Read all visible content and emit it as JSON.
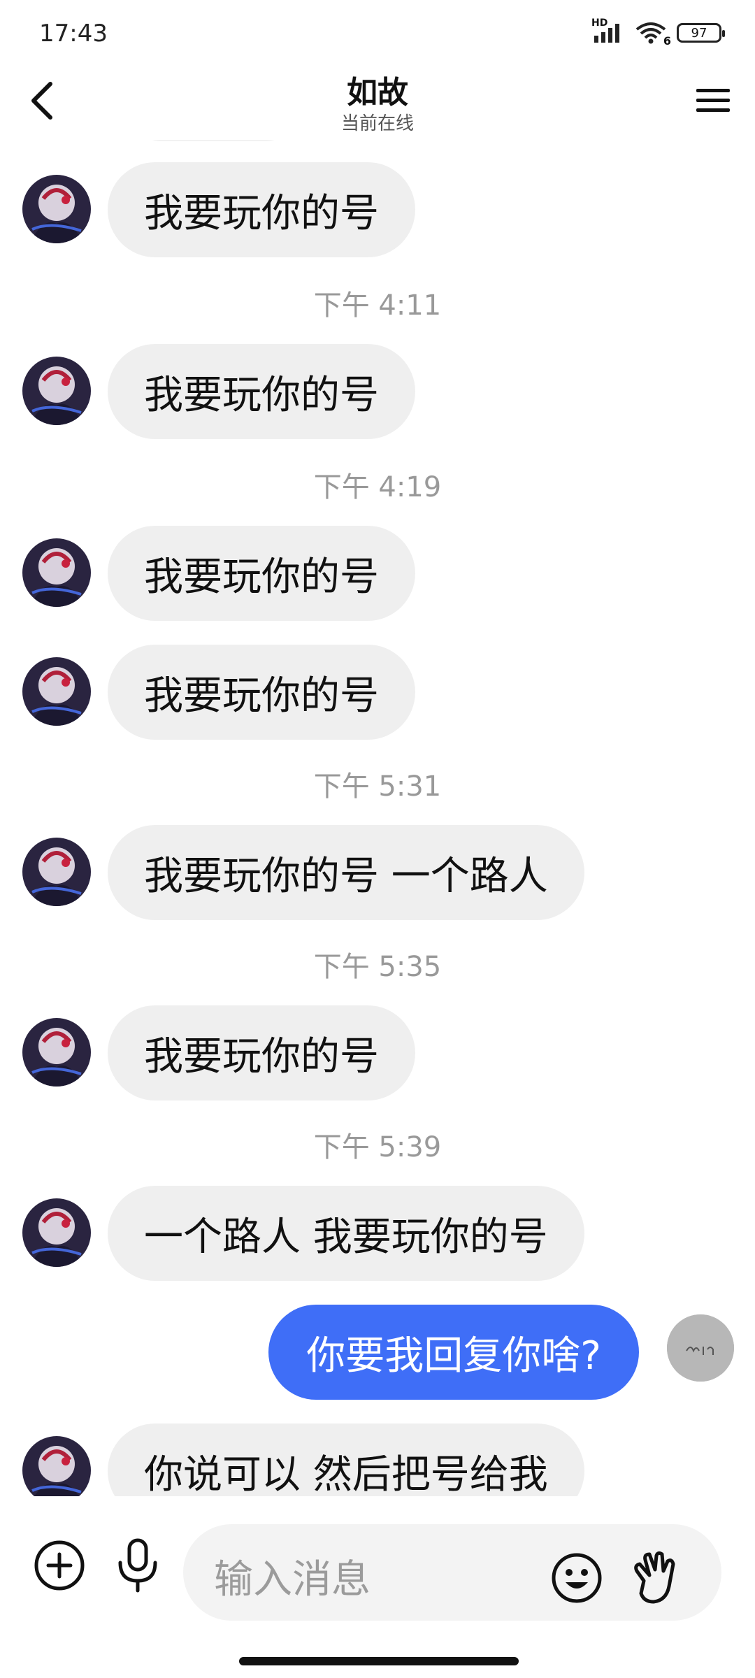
{
  "status": {
    "time": "17:43",
    "hd": "HD",
    "signal_sub": "6",
    "battery": "97"
  },
  "header": {
    "title": "如故",
    "subtitle": "当前在线"
  },
  "messages": {
    "m1": "我要玩你的号",
    "t1": "下午 4:11",
    "m2": "我要玩你的号",
    "t2": "下午 4:19",
    "m3": "我要玩你的号",
    "m4": "我要玩你的号",
    "t3": "下午 5:31",
    "m5": "我要玩你的号 一个路人",
    "t4": "下午 5:35",
    "m6": "我要玩你的号",
    "t5": "下午 5:39",
    "m7": "一个路人 我要玩你的号",
    "me1": "你要我回复你啥?",
    "m8": "你说可以 然后把号给我"
  },
  "input": {
    "placeholder": "输入消息"
  },
  "icons": {
    "back": "chevron-left-icon",
    "menu": "menu-icon",
    "add": "plus-circle-icon",
    "mic": "microphone-icon",
    "emoji": "emoji-icon",
    "gesture": "hand-icon"
  }
}
